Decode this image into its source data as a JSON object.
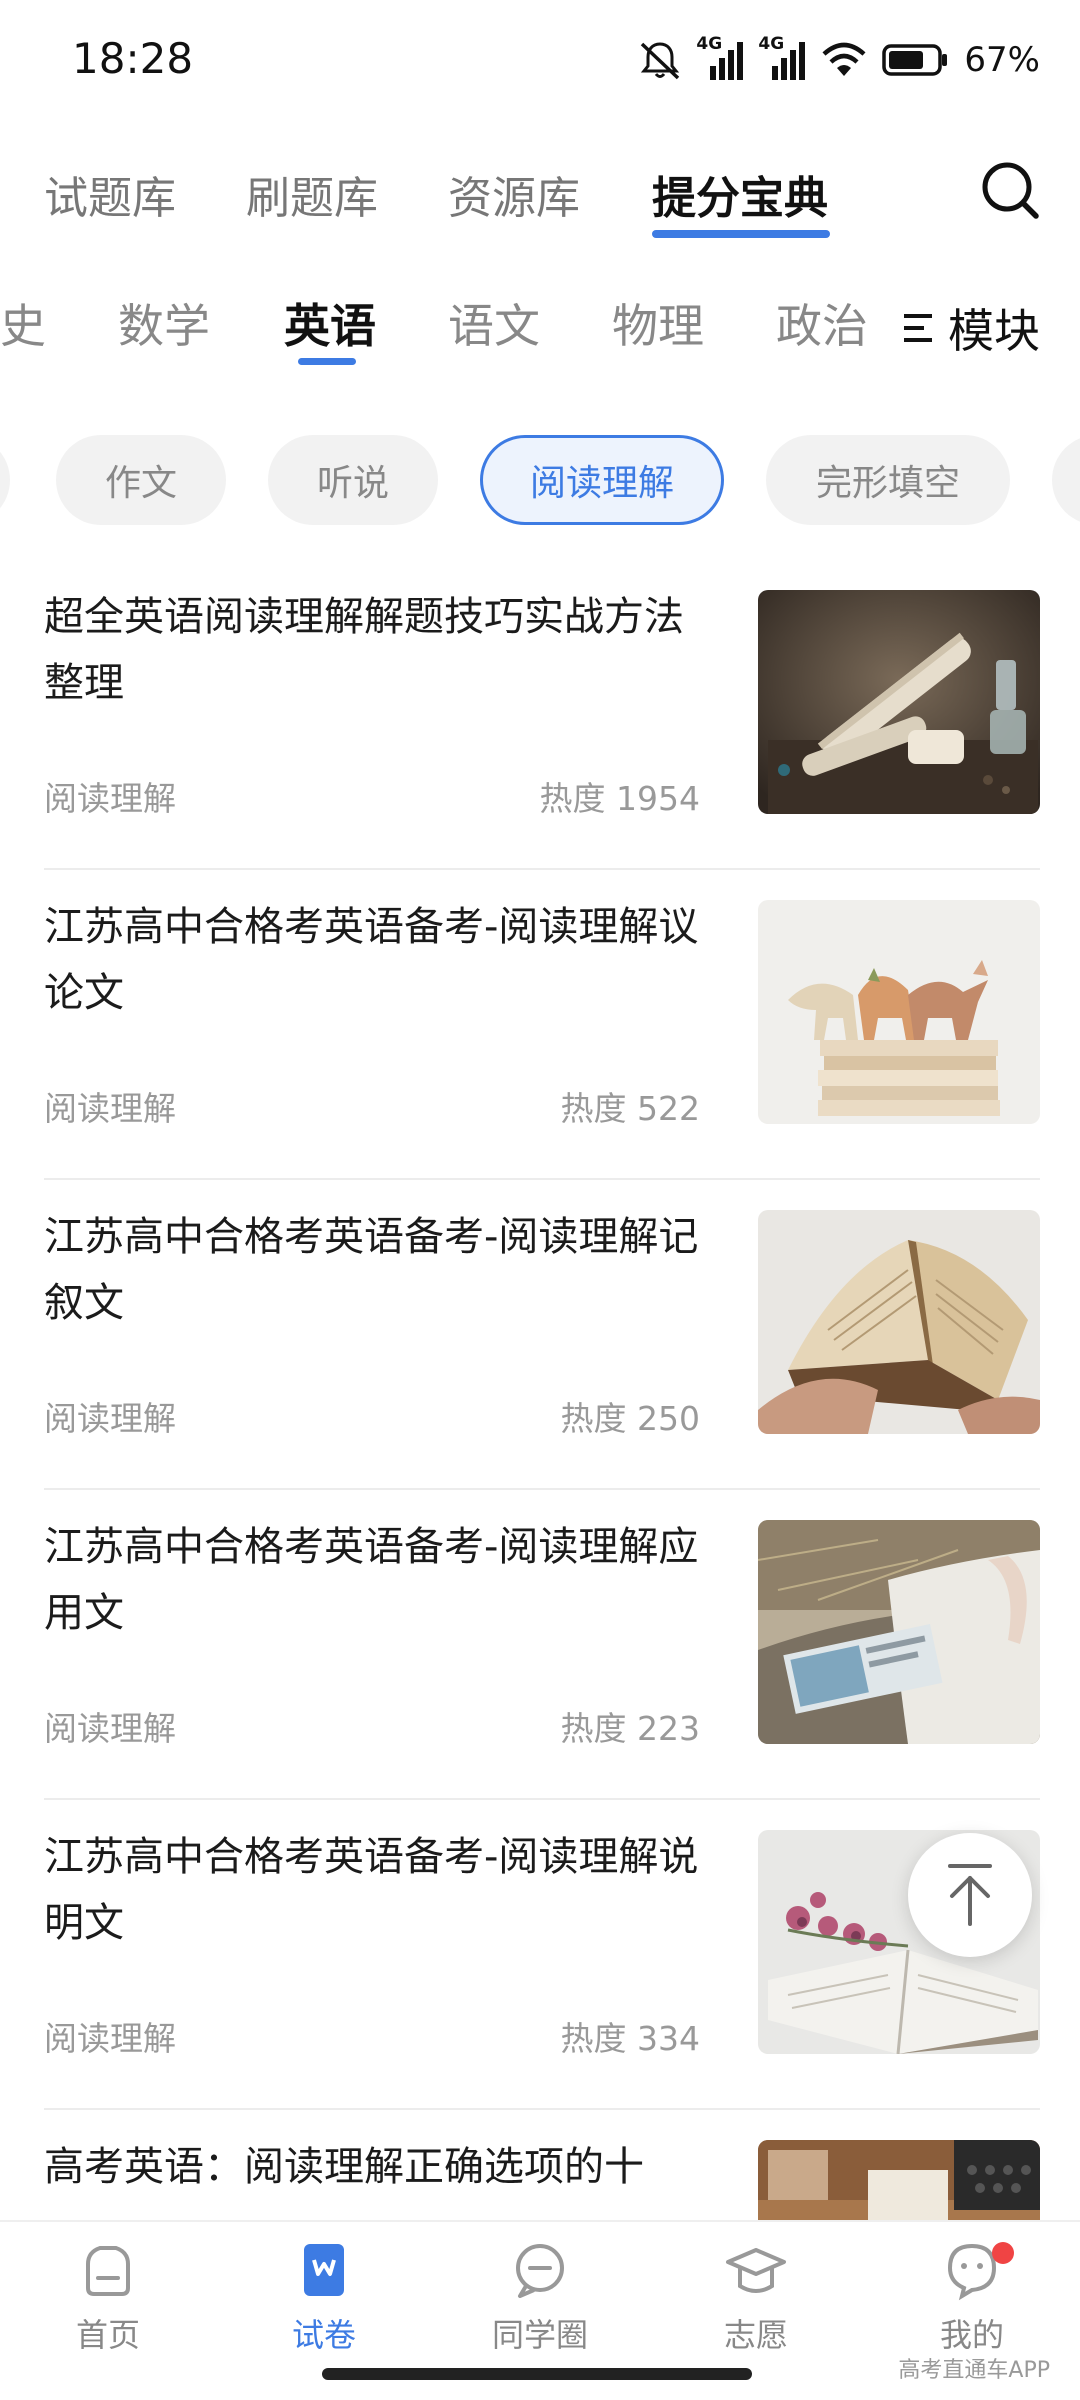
{
  "status": {
    "time": "18:28",
    "network_1": "4G",
    "network_2": "4G",
    "battery": "67%",
    "icons": [
      "mute-icon",
      "signal-icon",
      "signal-icon",
      "wifi-icon",
      "battery-icon"
    ]
  },
  "top_tabs": [
    {
      "label": "试题库",
      "active": false
    },
    {
      "label": "刷题库",
      "active": false
    },
    {
      "label": "资源库",
      "active": false
    },
    {
      "label": "提分宝典",
      "active": true
    }
  ],
  "subject_tabs": [
    {
      "label": "史",
      "active": false
    },
    {
      "label": "数学",
      "active": false
    },
    {
      "label": "英语",
      "active": true
    },
    {
      "label": "语文",
      "active": false
    },
    {
      "label": "物理",
      "active": false
    },
    {
      "label": "政治",
      "active": false
    }
  ],
  "module_button": {
    "label": "模块",
    "icon": "menu-icon"
  },
  "chips": [
    {
      "label": "",
      "active": false
    },
    {
      "label": "作文",
      "active": false
    },
    {
      "label": "听说",
      "active": false
    },
    {
      "label": "阅读理解",
      "active": true
    },
    {
      "label": "完形填空",
      "active": false
    },
    {
      "label": "",
      "active": false
    }
  ],
  "articles": [
    {
      "title": "超全英语阅读理解解题技巧实战方法整理",
      "category": "阅读理解",
      "hot": "热度 1954",
      "thumb": "scrolls-photo"
    },
    {
      "title": "江苏高中合格考英语备考-阅读理解议论文",
      "category": "阅读理解",
      "hot": "热度 522",
      "thumb": "toy-dinosaurs-books-photo"
    },
    {
      "title": "江苏高中合格考英语备考-阅读理解记叙文",
      "category": "阅读理解",
      "hot": "热度 250",
      "thumb": "open-book-hand-photo"
    },
    {
      "title": "江苏高中合格考英语备考-阅读理解应用文",
      "category": "阅读理解",
      "hot": "热度 223",
      "thumb": "magazine-table-photo"
    },
    {
      "title": "江苏高中合格考英语备考-阅读理解说明文",
      "category": "阅读理解",
      "hot": "热度 334",
      "thumb": "flowers-book-photo"
    },
    {
      "title": "高考英语：阅读理解正确选项的十",
      "category": "",
      "hot": "",
      "thumb": "typewriter-desk-photo"
    }
  ],
  "bottom_nav": [
    {
      "label": "首页",
      "icon": "home-icon",
      "active": false
    },
    {
      "label": "试卷",
      "icon": "paper-icon",
      "active": true
    },
    {
      "label": "同学圈",
      "icon": "chat-icon",
      "active": false
    },
    {
      "label": "志愿",
      "icon": "graduation-cap-icon",
      "active": false
    },
    {
      "label": "我的",
      "icon": "profile-icon",
      "active": false,
      "badge": true
    }
  ],
  "watermark": "高考直通车APP",
  "colors": {
    "accent": "#3d7be3",
    "badge": "#f04444"
  }
}
